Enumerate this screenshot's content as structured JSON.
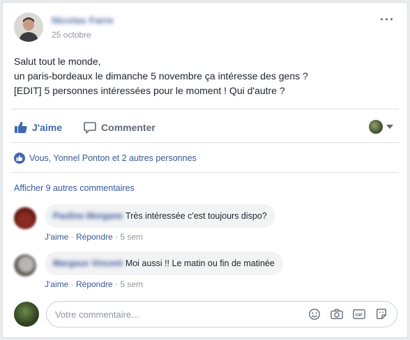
{
  "post": {
    "author": "Nicolas Farre",
    "date": "25 octobre",
    "more_label": "···",
    "lines": [
      "Salut tout le monde,",
      "un paris-bordeaux le dimanche 5 novembre ça intéresse des gens ?",
      "[EDIT] 5 personnes intéressées pour le moment ! Qui d'autre ?"
    ]
  },
  "actions": {
    "like_label": "J'aime",
    "comment_label": "Commenter"
  },
  "reactions": {
    "text": "Vous, Yonnel Ponton et 2 autres personnes"
  },
  "comments_view_more": "Afficher 9 autres commentaires",
  "comments": [
    {
      "name": "Pauline Morgane",
      "text": "Très intéressée c'est toujours dispo?",
      "like": "J'aime",
      "sep1": " · ",
      "reply": "Répondre",
      "sep2": " · ",
      "time": "5 sem"
    },
    {
      "name": "Margaux Vincent",
      "text": "Moi aussi !! Le matin ou fin de matinée",
      "like": "J'aime",
      "sep1": " · ",
      "reply": "Répondre",
      "sep2": " · ",
      "time": "5 sem"
    }
  ],
  "composer": {
    "placeholder": "Votre commentaire..."
  },
  "colors": {
    "accent": "#4267b2",
    "link": "#365899",
    "muted": "#90949c"
  },
  "icons": [
    "like-thumb-icon",
    "comment-bubble-icon",
    "emoji-icon",
    "camera-icon",
    "gif-icon",
    "sticker-icon"
  ]
}
